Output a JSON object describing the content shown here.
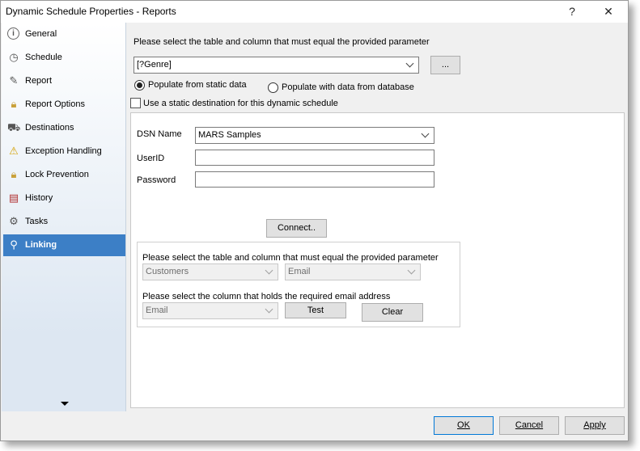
{
  "window": {
    "title": "Dynamic Schedule Properties - Reports",
    "help_label": "?",
    "close_label": "✕"
  },
  "sidebar": {
    "items": [
      {
        "label": "General",
        "icon": "info-icon"
      },
      {
        "label": "Schedule",
        "icon": "clock-icon"
      },
      {
        "label": "Report",
        "icon": "report-icon"
      },
      {
        "label": "Report Options",
        "icon": "lock-icon"
      },
      {
        "label": "Destinations",
        "icon": "truck-icon"
      },
      {
        "label": "Exception Handling",
        "icon": "warning-icon"
      },
      {
        "label": "Lock Prevention",
        "icon": "lock-icon"
      },
      {
        "label": "History",
        "icon": "history-icon"
      },
      {
        "label": "Tasks",
        "icon": "tasks-icon"
      },
      {
        "label": "Linking",
        "icon": "link-icon",
        "selected": true
      }
    ]
  },
  "main": {
    "table_prompt": "Please select the table and column that must equal the provided parameter",
    "parameter_value": "[?Genre]",
    "browse_label": "...",
    "radio_static": "Populate from static data",
    "radio_database": "Populate with data from database",
    "static_dest_label": "Use a static destination for this dynamic schedule",
    "dsn_label": "DSN Name",
    "dsn_value": "MARS Samples",
    "userid_label": "UserID",
    "userid_value": "",
    "password_label": "Password",
    "password_value": "",
    "connect_label": "Connect..",
    "sub_table_prompt": "Please select the table and column that must equal the provided parameter",
    "table_value": "Customers",
    "column_value": "Email",
    "email_column_prompt": "Please select the column that holds the required email address",
    "email_column_value": "Email",
    "test_label": "Test",
    "clear_label": "Clear"
  },
  "footer": {
    "ok_label": "OK",
    "cancel_label": "Cancel",
    "apply_label": "Apply"
  }
}
